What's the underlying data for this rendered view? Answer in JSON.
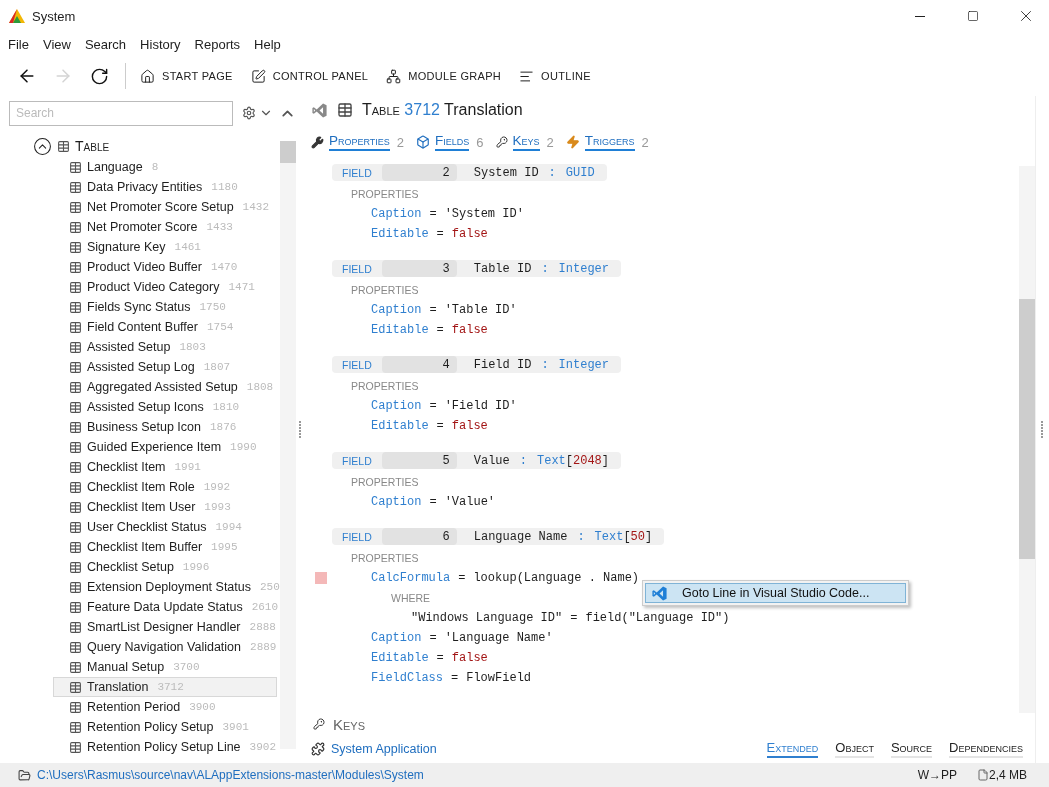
{
  "window": {
    "title": "System"
  },
  "menu": [
    "File",
    "View",
    "Search",
    "History",
    "Reports",
    "Help"
  ],
  "nav": [
    {
      "kind": "back",
      "disabled": false
    },
    {
      "kind": "forward",
      "disabled": true
    },
    {
      "kind": "refresh",
      "disabled": false
    }
  ],
  "toolbar": [
    {
      "kind": "home",
      "label": "START PAGE"
    },
    {
      "kind": "panel",
      "label": "CONTROL PANEL"
    },
    {
      "kind": "graph",
      "label": "MODULE GRAPH"
    },
    {
      "kind": "outline",
      "label": "OUTLINE"
    }
  ],
  "search": {
    "placeholder": "Search"
  },
  "tree": {
    "label": "Table",
    "expanded": true,
    "items": [
      {
        "name": "Language",
        "id": "8",
        "selected": false
      },
      {
        "name": "Data Privacy Entities",
        "id": "1180",
        "selected": false
      },
      {
        "name": "Net Promoter Score Setup",
        "id": "1432",
        "selected": false
      },
      {
        "name": "Net Promoter Score",
        "id": "1433",
        "selected": false
      },
      {
        "name": "Signature Key",
        "id": "1461",
        "selected": false
      },
      {
        "name": "Product Video Buffer",
        "id": "1470",
        "selected": false
      },
      {
        "name": "Product Video Category",
        "id": "1471",
        "selected": false
      },
      {
        "name": "Fields Sync Status",
        "id": "1750",
        "selected": false
      },
      {
        "name": "Field Content Buffer",
        "id": "1754",
        "selected": false
      },
      {
        "name": "Assisted Setup",
        "id": "1803",
        "selected": false
      },
      {
        "name": "Assisted Setup Log",
        "id": "1807",
        "selected": false
      },
      {
        "name": "Aggregated Assisted Setup",
        "id": "1808",
        "selected": false
      },
      {
        "name": "Assisted Setup Icons",
        "id": "1810",
        "selected": false
      },
      {
        "name": "Business Setup Icon",
        "id": "1876",
        "selected": false
      },
      {
        "name": "Guided Experience Item",
        "id": "1990",
        "selected": false
      },
      {
        "name": "Checklist Item",
        "id": "1991",
        "selected": false
      },
      {
        "name": "Checklist Item Role",
        "id": "1992",
        "selected": false
      },
      {
        "name": "Checklist Item User",
        "id": "1993",
        "selected": false
      },
      {
        "name": "User Checklist Status",
        "id": "1994",
        "selected": false
      },
      {
        "name": "Checklist Item Buffer",
        "id": "1995",
        "selected": false
      },
      {
        "name": "Checklist Setup",
        "id": "1996",
        "selected": false
      },
      {
        "name": "Extension Deployment Status",
        "id": "250",
        "selected": false
      },
      {
        "name": "Feature Data Update Status",
        "id": "2610",
        "selected": false
      },
      {
        "name": "SmartList Designer Handler",
        "id": "2888",
        "selected": false
      },
      {
        "name": "Query Navigation Validation",
        "id": "2889",
        "selected": false
      },
      {
        "name": "Manual Setup",
        "id": "3700",
        "selected": false
      },
      {
        "name": "Translation",
        "id": "3712",
        "selected": true
      },
      {
        "name": "Retention Period",
        "id": "3900",
        "selected": false
      },
      {
        "name": "Retention Policy Setup",
        "id": "3901",
        "selected": false
      },
      {
        "name": "Retention Policy Setup Line",
        "id": "3902",
        "selected": false
      }
    ]
  },
  "object": {
    "kind_label": "Table",
    "number": "3712",
    "name": "Translation"
  },
  "sections": [
    {
      "kind": "properties",
      "label": "Properties",
      "count": "2"
    },
    {
      "kind": "fields",
      "label": "Fields",
      "count": "6"
    },
    {
      "kind": "keys",
      "label": "Keys",
      "count": "2"
    },
    {
      "kind": "triggers",
      "label": "Triggers",
      "count": "2"
    }
  ],
  "fields": [
    {
      "label": "FIELD",
      "number": "2",
      "name": "System ID",
      "colon": ":",
      "type": "GUID",
      "properties_label": "PROPERTIES",
      "properties": [
        {
          "key": "Caption",
          "op": "=",
          "value": "'System ID'",
          "kind": "text",
          "marked": false
        },
        {
          "key": "Editable",
          "op": "=",
          "value": "false",
          "kind": "bool",
          "marked": false
        }
      ]
    },
    {
      "label": "FIELD",
      "number": "3",
      "name": "Table ID",
      "colon": ":",
      "type": "Integer",
      "properties_label": "PROPERTIES",
      "properties": [
        {
          "key": "Caption",
          "op": "=",
          "value": "'Table ID'",
          "kind": "text",
          "marked": false
        },
        {
          "key": "Editable",
          "op": "=",
          "value": "false",
          "kind": "bool",
          "marked": false
        }
      ]
    },
    {
      "label": "FIELD",
      "number": "4",
      "name": "Field ID",
      "colon": ":",
      "type": "Integer",
      "properties_label": "PROPERTIES",
      "properties": [
        {
          "key": "Caption",
          "op": "=",
          "value": "'Field ID'",
          "kind": "text",
          "marked": false
        },
        {
          "key": "Editable",
          "op": "=",
          "value": "false",
          "kind": "bool",
          "marked": false
        }
      ]
    },
    {
      "label": "FIELD",
      "number": "5",
      "name": "Value",
      "colon": ":",
      "type": "Text",
      "size_open": "[",
      "size": "2048",
      "size_close": "]",
      "properties_label": "PROPERTIES",
      "properties": [
        {
          "key": "Caption",
          "op": "=",
          "value": "'Value'",
          "kind": "text",
          "marked": false
        }
      ]
    },
    {
      "label": "FIELD",
      "number": "6",
      "name": "Language Name",
      "colon": ":",
      "type": "Text",
      "size_open": "[",
      "size": "50",
      "size_close": "]",
      "properties_label": "PROPERTIES",
      "properties": [
        {
          "key": "CalcFormula",
          "op": "=",
          "value": "lookup(Language . Name)",
          "kind": "text",
          "marked": true,
          "where_label": "WHERE",
          "where": {
            "left": "\"Windows Language ID\"",
            "op": "=",
            "right": "field(\"Language ID\")"
          }
        },
        {
          "key": "Caption",
          "op": "=",
          "value": "'Language Name'",
          "kind": "text",
          "marked": false
        },
        {
          "key": "Editable",
          "op": "=",
          "value": "false",
          "kind": "bool",
          "marked": false
        },
        {
          "key": "FieldClass",
          "op": "=",
          "value": "FlowField",
          "kind": "text",
          "marked": false
        }
      ]
    }
  ],
  "context_menu": {
    "label": "Goto Line in Visual Studio Code..."
  },
  "keys_header": "Keys",
  "footer": {
    "app": "System Application",
    "tabs": [
      {
        "label": "Extended",
        "selected": true
      },
      {
        "label": "Object",
        "selected": false
      },
      {
        "label": "Source",
        "selected": false
      },
      {
        "label": "Dependencies",
        "selected": false
      }
    ]
  },
  "status_bar": {
    "path": "C:\\Users\\Rasmus\\source\\nav\\ALAppExtensions-master\\Modules\\System",
    "mode": "W→PP",
    "size": "2,4 MB"
  }
}
